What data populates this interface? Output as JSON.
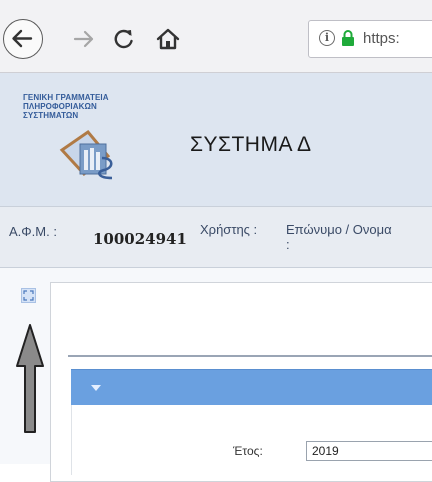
{
  "browser": {
    "url_text": "https:",
    "icons": [
      "back-arrow-icon",
      "forward-arrow-icon",
      "reload-icon",
      "home-icon",
      "info-icon",
      "lock-icon"
    ],
    "info_glyph": "i",
    "lock_color": "#1faa3a"
  },
  "header": {
    "org_line1": "ΓΕΝΙΚΗ ΓΡΑΜΜΑΤΕΙΑ",
    "org_line2": "ΠΛΗΡΟΦΟΡΙΑΚΩΝ ΣΥΣΤΗΜΑΤΩΝ",
    "title": "ΣΥΣΤΗΜΑ Δ",
    "background": "#dde5f0"
  },
  "user_bar": {
    "afm_label": "Α.Φ.Μ. :",
    "afm_value": "100024941",
    "user_label": "Χρήστης :",
    "name_label": "Επώνυμο / Ονομα :"
  },
  "form": {
    "year_label": "Έτος:",
    "year_value": "2019",
    "panel_color": "#6aa0e0"
  }
}
